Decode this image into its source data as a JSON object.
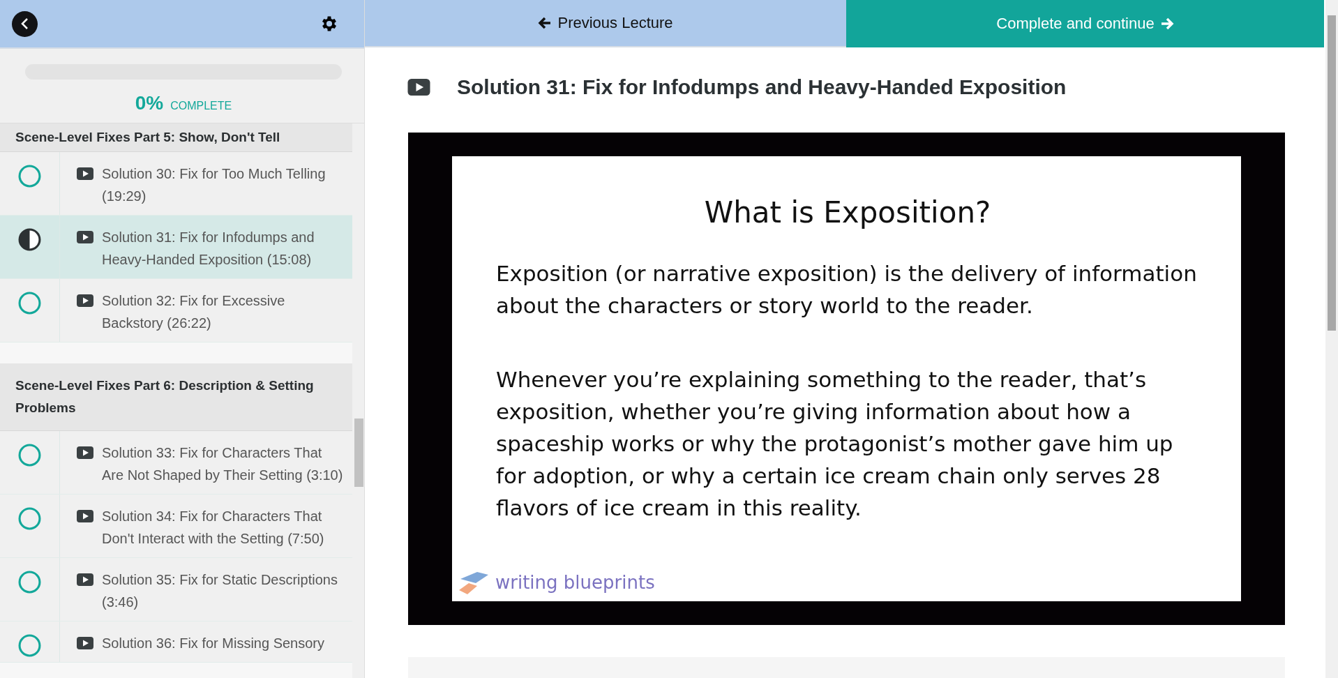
{
  "sidebar": {
    "progress": {
      "level": 0,
      "percent": "0%",
      "label": "COMPLETE"
    },
    "sections": [
      {
        "title": "Scene-Level Fixes Part 5: Show, Don't Tell",
        "lectures": [
          {
            "title": "Solution 30: Fix for Too Much Telling (19:29)",
            "in_progress": false,
            "selected": false
          },
          {
            "title": "Solution 31: Fix for Infodumps and Heavy-Handed Exposition (15:08)",
            "in_progress": true,
            "selected": true
          },
          {
            "title": "Solution 32: Fix for Excessive Backstory (26:22)",
            "in_progress": false,
            "selected": false
          }
        ]
      },
      {
        "title": "Scene-Level Fixes Part 6: Description & Setting Problems",
        "lectures": [
          {
            "title": "Solution 33: Fix for Characters That Are Not Shaped by Their Setting (3:10)",
            "in_progress": false,
            "selected": false
          },
          {
            "title": "Solution 34: Fix for Characters That Don't Interact with the Setting (7:50)",
            "in_progress": false,
            "selected": false
          },
          {
            "title": "Solution 35: Fix for Static Descriptions (3:46)",
            "in_progress": false,
            "selected": false
          },
          {
            "title": "Solution 36: Fix for Missing Sensory",
            "in_progress": false,
            "selected": false
          }
        ]
      }
    ]
  },
  "nav": {
    "previous": "Previous Lecture",
    "next": "Complete and continue"
  },
  "lecture": {
    "title": "Solution 31: Fix for Infodumps and Heavy-Handed Exposition",
    "slide": {
      "title": "What is Exposition?",
      "paragraphs": [
        "Exposition (or narrative exposition) is the delivery of information about the characters or story world to the reader.",
        "Whenever you’re explaining something to the reader, that’s exposition, whether you’re giving information about how a spaceship works or why the protagonist’s mother gave him up for adoption, or why a certain ice cream chain only serves 28 flavors of ice cream in this reality."
      ],
      "brand": "writing blueprints"
    }
  }
}
